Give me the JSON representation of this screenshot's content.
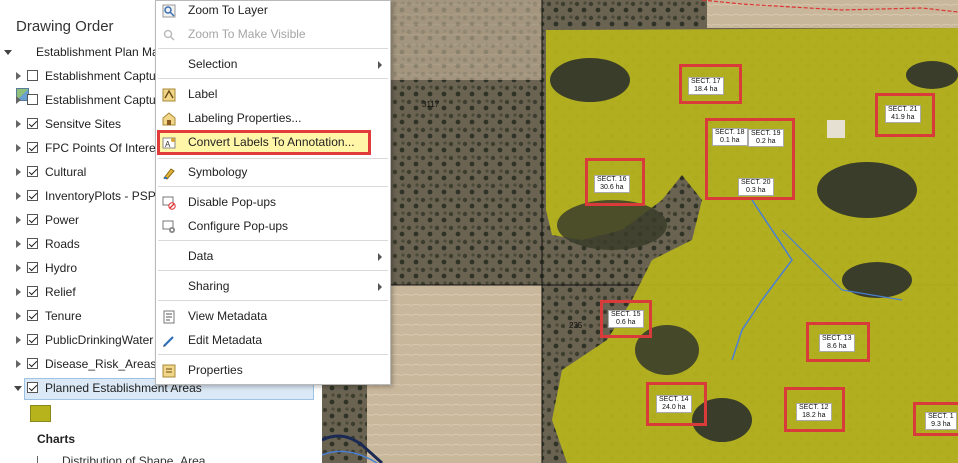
{
  "contents": {
    "title": "Drawing Order",
    "map_name": "Establishment Plan Ma",
    "layers": [
      {
        "label": "Establishment Captu",
        "checked": false
      },
      {
        "label": "Establishment Captu",
        "checked": false
      },
      {
        "label": "Sensitve Sites",
        "checked": true
      },
      {
        "label": "FPC Points Of Interest",
        "checked": true
      },
      {
        "label": "Cultural",
        "checked": true
      },
      {
        "label": "InventoryPlots - PSP",
        "checked": true
      },
      {
        "label": "Power",
        "checked": true
      },
      {
        "label": "Roads",
        "checked": true
      },
      {
        "label": "Hydro",
        "checked": true
      },
      {
        "label": "Relief",
        "checked": true
      },
      {
        "label": "Tenure",
        "checked": true
      },
      {
        "label": "PublicDrinkingWater",
        "checked": true
      },
      {
        "label": "Disease_Risk_Areas",
        "checked": true
      },
      {
        "label": "Planned Establishment Areas",
        "checked": true
      }
    ],
    "swatch_color": "#b6b31c",
    "charts_label": "Charts",
    "chart_item": "Distribution of Shape_Area"
  },
  "context_menu": {
    "items": [
      {
        "label": "Zoom To Layer",
        "icon": "zoom-layer-icon",
        "disabled": false
      },
      {
        "label": "Zoom To Make Visible",
        "icon": "zoom-visible-icon",
        "disabled": true
      },
      {
        "label": "Selection",
        "submenu": true
      },
      {
        "label": "Label",
        "icon": "label-icon"
      },
      {
        "label": "Labeling Properties...",
        "icon": "labeling-properties-icon"
      },
      {
        "label": "Convert Labels To Annotation...",
        "icon": "convert-annotation-icon",
        "highlighted": true
      },
      {
        "label": "Symbology",
        "icon": "symbology-icon"
      },
      {
        "label": "Disable Pop-ups",
        "icon": "disable-popups-icon"
      },
      {
        "label": "Configure Pop-ups",
        "icon": "configure-popups-icon"
      },
      {
        "label": "Data",
        "submenu": true
      },
      {
        "label": "Sharing",
        "submenu": true
      },
      {
        "label": "View Metadata",
        "icon": "view-metadata-icon"
      },
      {
        "label": "Edit Metadata",
        "icon": "edit-metadata-icon"
      },
      {
        "label": "Properties",
        "icon": "properties-icon"
      }
    ],
    "highlight_color": "#e23b3b"
  },
  "map": {
    "labels_plain": [
      "3117",
      "235"
    ],
    "sections": [
      {
        "name": "SECT. 17",
        "area": "18.4 ha"
      },
      {
        "name": "SECT. 18",
        "area": "0.1 ha"
      },
      {
        "name": "SECT. 19",
        "area": "0.2 ha"
      },
      {
        "name": "SECT. 20",
        "area": "0.3 ha"
      },
      {
        "name": "SECT. 21",
        "area": "41.9 ha"
      },
      {
        "name": "SECT. 16",
        "area": "30.6 ha"
      },
      {
        "name": "SECT. 15",
        "area": "0.6 ha"
      },
      {
        "name": "SECT. 13",
        "area": "8.6 ha"
      },
      {
        "name": "SECT. 14",
        "area": "24.0 ha"
      },
      {
        "name": "SECT. 12",
        "area": "18.2 ha"
      },
      {
        "name": "SECT. 1",
        "area": "9.3 ha"
      }
    ],
    "colors": {
      "establishment_area": "#b5b21e",
      "highlight_box": "#d93a3a",
      "hydro": "#4a7fd4"
    }
  }
}
